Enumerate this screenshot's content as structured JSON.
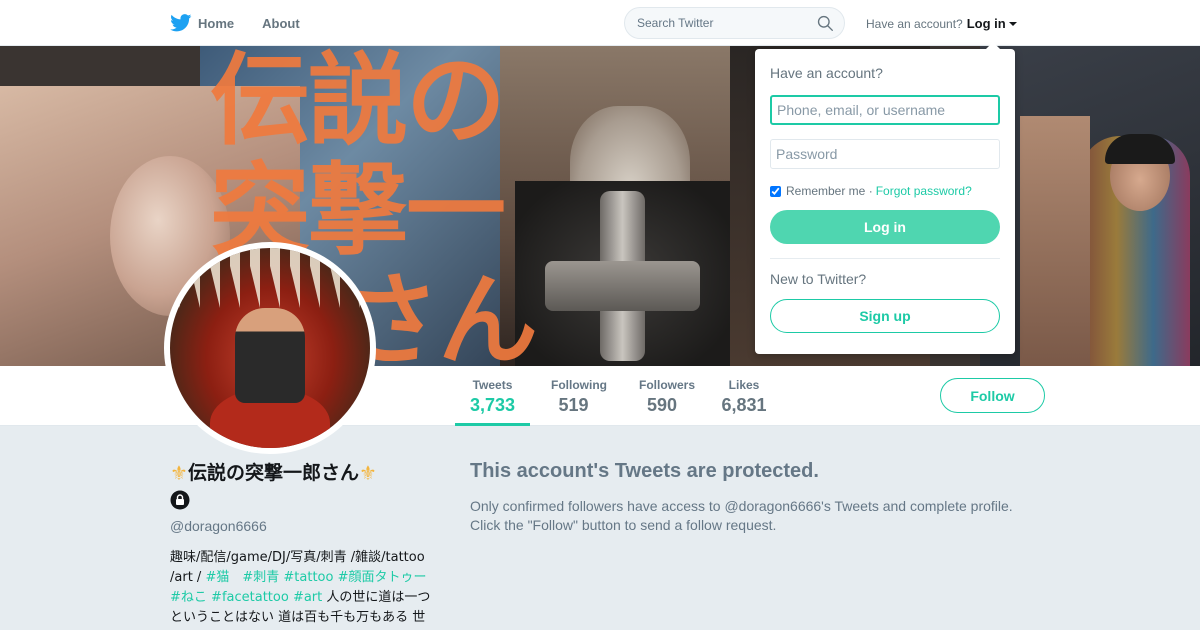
{
  "nav": {
    "home_label": "Home",
    "about_label": "About",
    "search_placeholder": "Search Twitter",
    "have_account": "Have an account?",
    "login_label": "Log in"
  },
  "banner": {
    "text_line1": "伝説の",
    "text_line2": "突撃一",
    "text_line3": "さん"
  },
  "stats": [
    {
      "label": "Tweets",
      "value": "3,733"
    },
    {
      "label": "Following",
      "value": "519"
    },
    {
      "label": "Followers",
      "value": "590"
    },
    {
      "label": "Likes",
      "value": "6,831"
    }
  ],
  "follow_label": "Follow",
  "profile": {
    "crown_left": "⚜",
    "name": "伝説の突撃一郎さん",
    "crown_right": "⚜",
    "handle": "@doragon6666",
    "bio_text1": "趣味/配信/game/DJ/写真/刺青 /雑談/tattoo /art / ",
    "bio_tags": [
      "#猫",
      "#刺青",
      "#tattoo",
      "#顔面タトゥー",
      "#ねこ",
      "#facetattoo",
      "#art"
    ],
    "bio_text2": " 人の世に道は一つということはない 道は百も千も万もある 世"
  },
  "protected": {
    "title": "This account's Tweets are protected.",
    "body_line1": "Only confirmed followers have access to @doragon6666's Tweets and complete profile.",
    "body_line2": "Click the \"Follow\" button to send a follow request."
  },
  "login_dropdown": {
    "title": "Have an account?",
    "username_placeholder": "Phone, email, or username",
    "password_placeholder": "Password",
    "remember_label": "Remember me",
    "separator": "·",
    "forgot_label": "Forgot password?",
    "login_button": "Log in",
    "new_label": "New to Twitter?",
    "signup_button": "Sign up"
  },
  "colors": {
    "accent": "#1dcaa6",
    "banner_text": "#f07a3e",
    "twitter_blue": "#1da1f2"
  },
  "icons": [
    "twitter-bird-icon",
    "search-icon",
    "chevron-down-icon",
    "lock-icon",
    "crown-icon"
  ]
}
